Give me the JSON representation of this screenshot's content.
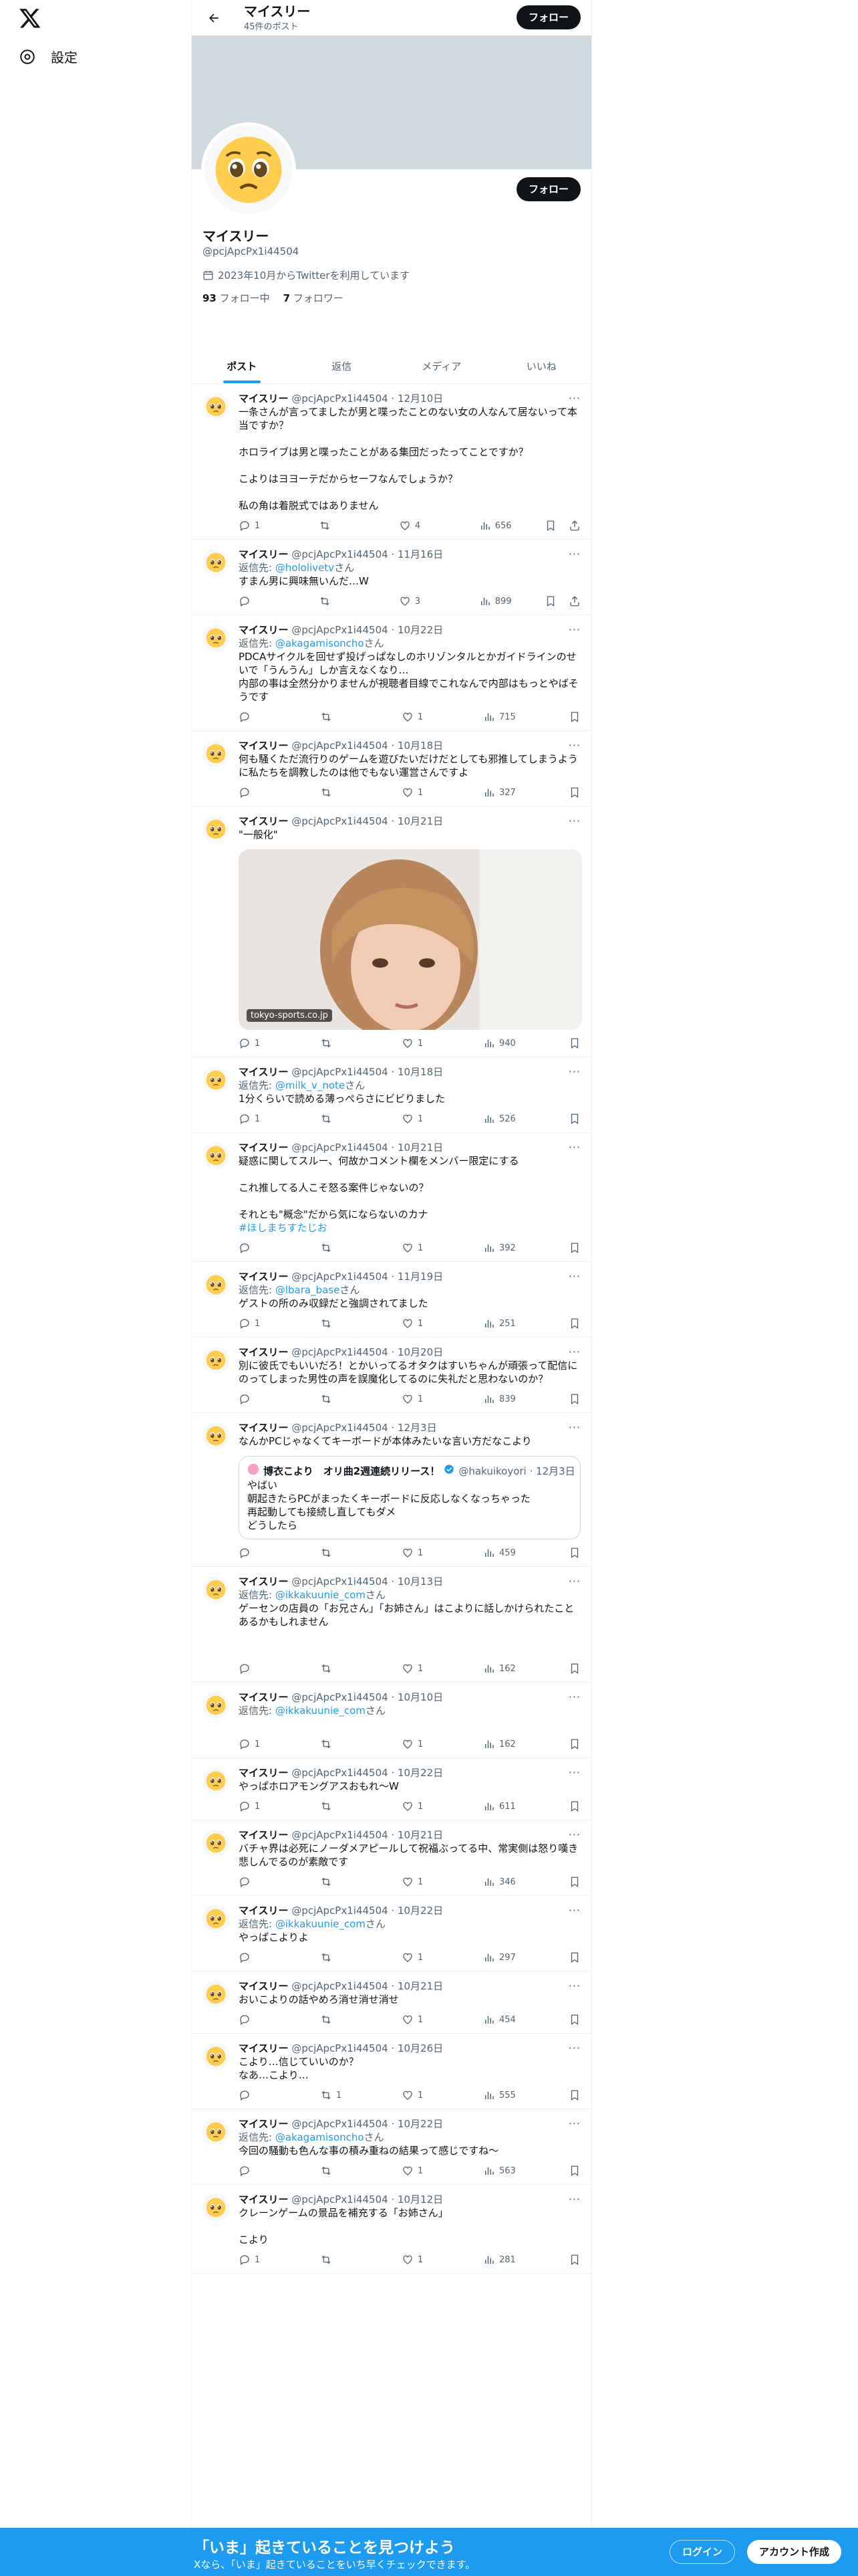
{
  "nav": {
    "settings_label": "設定"
  },
  "header": {
    "name": "マイスリー",
    "post_count": "45件のポスト",
    "follow_label": "フォロー"
  },
  "profile": {
    "name": "マイスリー",
    "handle": "@pcjApcPx1i44504",
    "joined": "2023年10月からTwitterを利用しています",
    "following_count": "93",
    "following_label": "フォロー中",
    "followers_count": "7",
    "followers_label": "フォロワー",
    "follow_label": "フォロー"
  },
  "tabs": [
    "ポスト",
    "返信",
    "メディア",
    "いいね"
  ],
  "tweets": [
    {
      "name": "マイスリー",
      "meta": "@pcjApcPx1i44504 · 12月10日",
      "reply_to": "",
      "text": "一条さんが言ってましたが男と喋ったことのない女の人なんて居ないって本当ですか？\n\nホロライブは男と喋ったことがある集団だったってことですか？\n\nこよりはヨヨーテだからセーフなんでしょうか？\n\n私の角は着脱式ではありません",
      "reply": "1",
      "retweet": "",
      "like": "4",
      "views": "656",
      "share": true
    },
    {
      "name": "マイスリー",
      "meta": "@pcjApcPx1i44504 · 11月16日",
      "reply_to": "@hololivetv",
      "text": "すまん男に興味無いんだ…W",
      "reply": "",
      "retweet": "",
      "like": "3",
      "views": "899",
      "share": true
    },
    {
      "name": "マイスリー",
      "meta": "@pcjApcPx1i44504 · 10月22日",
      "reply_to": "@akagamisoncho",
      "text": "PDCAサイクルを回せず投げっぱなしのホリゾンタルとかガイドラインのせいで「うんうん」しか言えなくなり…\n内部の事は全然分かりませんが視聴者目線でこれなんで内部はもっとやばそうです",
      "reply": "",
      "retweet": "",
      "like": "1",
      "views": "715",
      "share": false
    },
    {
      "name": "マイスリー",
      "meta": "@pcjApcPx1i44504 · 10月18日",
      "reply_to": "",
      "text": "何も騒くただ流行りのゲームを遊びたいだけだとしても邪推してしまうように私たちを調教したのは他でもない運営さんですよ",
      "reply": "",
      "retweet": "",
      "like": "1",
      "views": "327",
      "share": false
    },
    {
      "name": "マイスリー",
      "meta": "@pcjApcPx1i44504 · 10月21日",
      "reply_to": "",
      "text": "\"一般化\"",
      "media": "tokyo-sports.co.jp",
      "reply": "1",
      "retweet": "",
      "like": "1",
      "views": "940",
      "share": false
    },
    {
      "name": "マイスリー",
      "meta": "@pcjApcPx1i44504 · 10月18日",
      "reply_to": "@milk_v_note",
      "text": "1分くらいで読める薄っぺらさにビビりました",
      "reply": "1",
      "retweet": "",
      "like": "1",
      "views": "526",
      "share": false
    },
    {
      "name": "マイスリー",
      "meta": "@pcjApcPx1i44504 · 10月21日",
      "reply_to": "",
      "text": "疑惑に関してスルー、何故かコメント欄をメンバー限定にする\n\nこれ推してる人こそ怒る案件じゃないの？\n\nそれとも\"概念\"だから気にならないのカナ",
      "tag": "#ほしまちすたじお",
      "reply": "",
      "retweet": "",
      "like": "1",
      "views": "392",
      "share": false
    },
    {
      "name": "マイスリー",
      "meta": "@pcjApcPx1i44504 · 11月19日",
      "reply_to": "@lbara_base",
      "text": "ゲストの所のみ収録だと強調されてました",
      "reply": "1",
      "retweet": "",
      "like": "1",
      "views": "251",
      "share": false
    },
    {
      "name": "マイスリー",
      "meta": "@pcjApcPx1i44504 · 10月20日",
      "reply_to": "",
      "text": "別に彼氏でもいいだろ！とかいってるオタクはすいちゃんが頑張って配信にのってしまった男性の声を誤魔化してるのに失礼だと思わないのか？",
      "reply": "",
      "retweet": "",
      "like": "1",
      "views": "839",
      "share": false
    },
    {
      "name": "マイスリー",
      "meta": "@pcjApcPx1i44504 · 12月3日",
      "reply_to": "",
      "text": "なんかPCじゃなくてキーボードが本体みたいな言い方だなこより",
      "quote": {
        "name": "博衣こより　オリ曲2週連続リリース！",
        "meta": "@hakuikoyori · 12月3日",
        "text": "やばい\n朝起きたらPCがまったくキーボードに反応しなくなっちゃった\n再起動しても接続し直してもダメ\nどうしたら"
      },
      "reply": "",
      "retweet": "",
      "like": "1",
      "views": "459",
      "share": false
    },
    {
      "name": "マイスリー",
      "meta": "@pcjApcPx1i44504 · 10月13日",
      "reply_to": "@ikkakuunie_com",
      "text": "ゲーセンの店員の「お兄さん」「お姉さん」はこよりに話しかけられたことあるかもしれません",
      "reply": "",
      "retweet": "",
      "like": "1",
      "views": "162",
      "share": false,
      "extra": 40
    },
    {
      "name": "マイスリー",
      "meta": "@pcjApcPx1i44504 · 10月10日",
      "reply_to": "@ikkakuunie_com",
      "text": "",
      "reply": "1",
      "retweet": "",
      "like": "1",
      "views": "162",
      "share": false,
      "extra": 20
    },
    {
      "name": "マイスリー",
      "meta": "@pcjApcPx1i44504 · 10月22日",
      "reply_to": "",
      "text": "やっぱホロアモングアスおもれ〜W",
      "reply": "1",
      "retweet": "",
      "like": "1",
      "views": "611",
      "share": false
    },
    {
      "name": "マイスリー",
      "meta": "@pcjApcPx1i44504 · 10月21日",
      "reply_to": "",
      "text": "バチャ界は必死にノーダメアピールして祝福ぶってる中、常実側は怒り嘆き悲しんでるのが素敵です",
      "reply": "",
      "retweet": "",
      "like": "1",
      "views": "346",
      "share": false
    },
    {
      "name": "マイスリー",
      "meta": "@pcjApcPx1i44504 · 10月22日",
      "reply_to": "@ikkakuunie_com",
      "text": "やっぱこよりよ",
      "reply": "",
      "retweet": "",
      "like": "1",
      "views": "297",
      "share": false
    },
    {
      "name": "マイスリー",
      "meta": "@pcjApcPx1i44504 · 10月21日",
      "reply_to": "",
      "text": "おいこよりの話やめろ消せ消せ消せ",
      "reply": "",
      "retweet": "",
      "like": "1",
      "views": "454",
      "share": false
    },
    {
      "name": "マイスリー",
      "meta": "@pcjApcPx1i44504 · 10月26日",
      "reply_to": "",
      "text": "こより…信じていいのか？\nなあ…こより…",
      "reply": "",
      "retweet": "1",
      "like": "1",
      "views": "555",
      "share": false
    },
    {
      "name": "マイスリー",
      "meta": "@pcjApcPx1i44504 · 10月22日",
      "reply_to": "@akagamisoncho",
      "text": "今回の騒動も色んな事の積み重ねの結果って感じですね〜",
      "reply": "",
      "retweet": "",
      "like": "1",
      "views": "563",
      "share": false
    },
    {
      "name": "マイスリー",
      "meta": "@pcjApcPx1i44504 · 10月12日",
      "reply_to": "",
      "text": "クレーンゲームの景品を補充する「お姉さん」\n\nこより",
      "reply": "1",
      "retweet": "",
      "like": "1",
      "views": "281",
      "share": false
    }
  ],
  "reply_prefix": "返信先: ",
  "reply_suffix": "さん",
  "bottom": {
    "title": "「いま」起きていることを見つけよう",
    "subtitle": "Xなら、「いま」起きていることをいち早くチェックできます。",
    "login": "ログイン",
    "signup": "アカウント作成"
  }
}
